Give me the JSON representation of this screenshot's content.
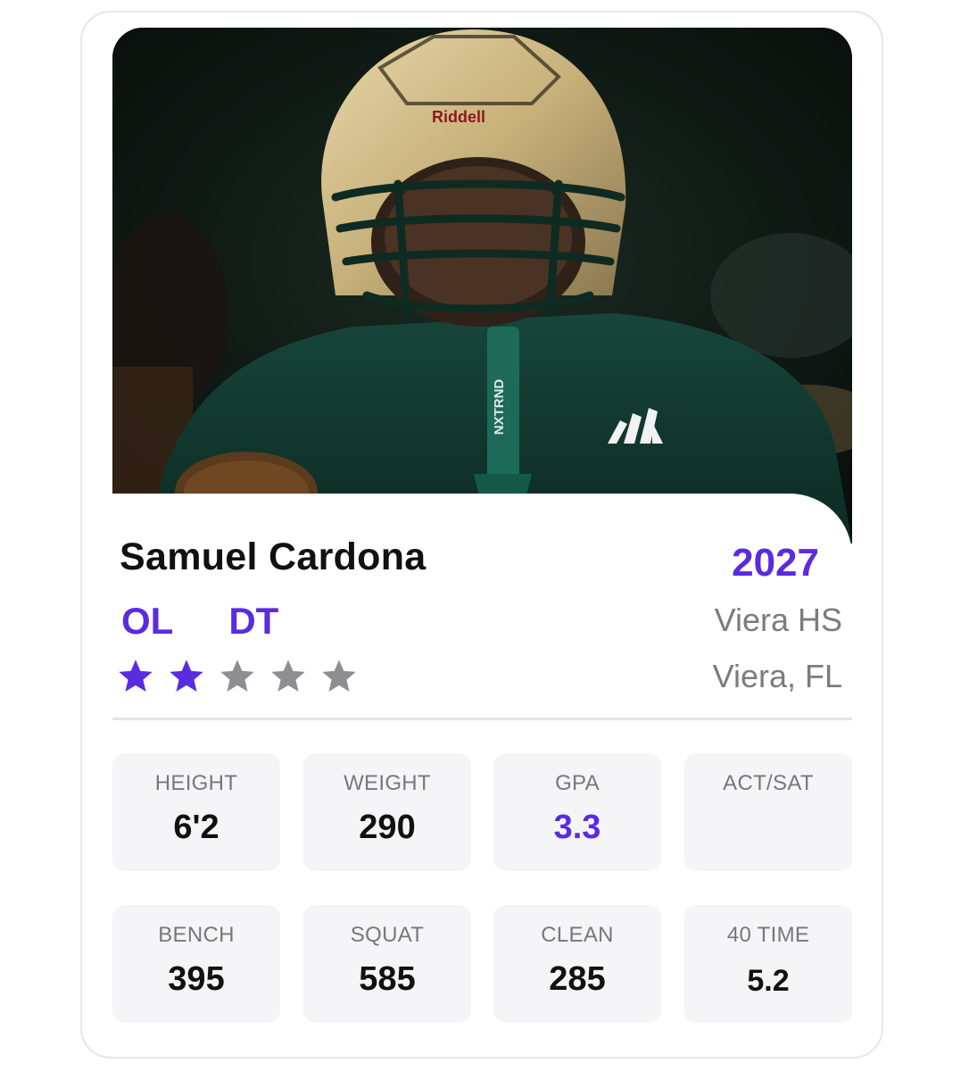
{
  "player": {
    "name": "Samuel Cardona",
    "class_year": "2027",
    "positions": [
      "OL",
      "DT"
    ],
    "school": "Viera HS",
    "location": "Viera, FL",
    "star_rating": 2,
    "star_max": 5
  },
  "photo": {
    "helmet_brand": "Riddell",
    "chinstrap_text": "NXTRND"
  },
  "stats": [
    {
      "label": "HEIGHT",
      "value": "6'2"
    },
    {
      "label": "WEIGHT",
      "value": "290"
    },
    {
      "label": "GPA",
      "value": "3.3"
    },
    {
      "label": "ACT/SAT",
      "value": ""
    },
    {
      "label": "BENCH",
      "value": "395"
    },
    {
      "label": "SQUAT",
      "value": "585"
    },
    {
      "label": "CLEAN",
      "value": "285"
    },
    {
      "label": "40 TIME",
      "value": "5.2"
    }
  ],
  "colors": {
    "accent": "#5a2be0",
    "star_filled": "#5a2be0",
    "star_empty": "#8e8e92",
    "name_text": "#111111",
    "muted_text": "#7b7b80",
    "stat_bg": "#f5f5f7"
  },
  "icons": {
    "star": "star-icon"
  }
}
